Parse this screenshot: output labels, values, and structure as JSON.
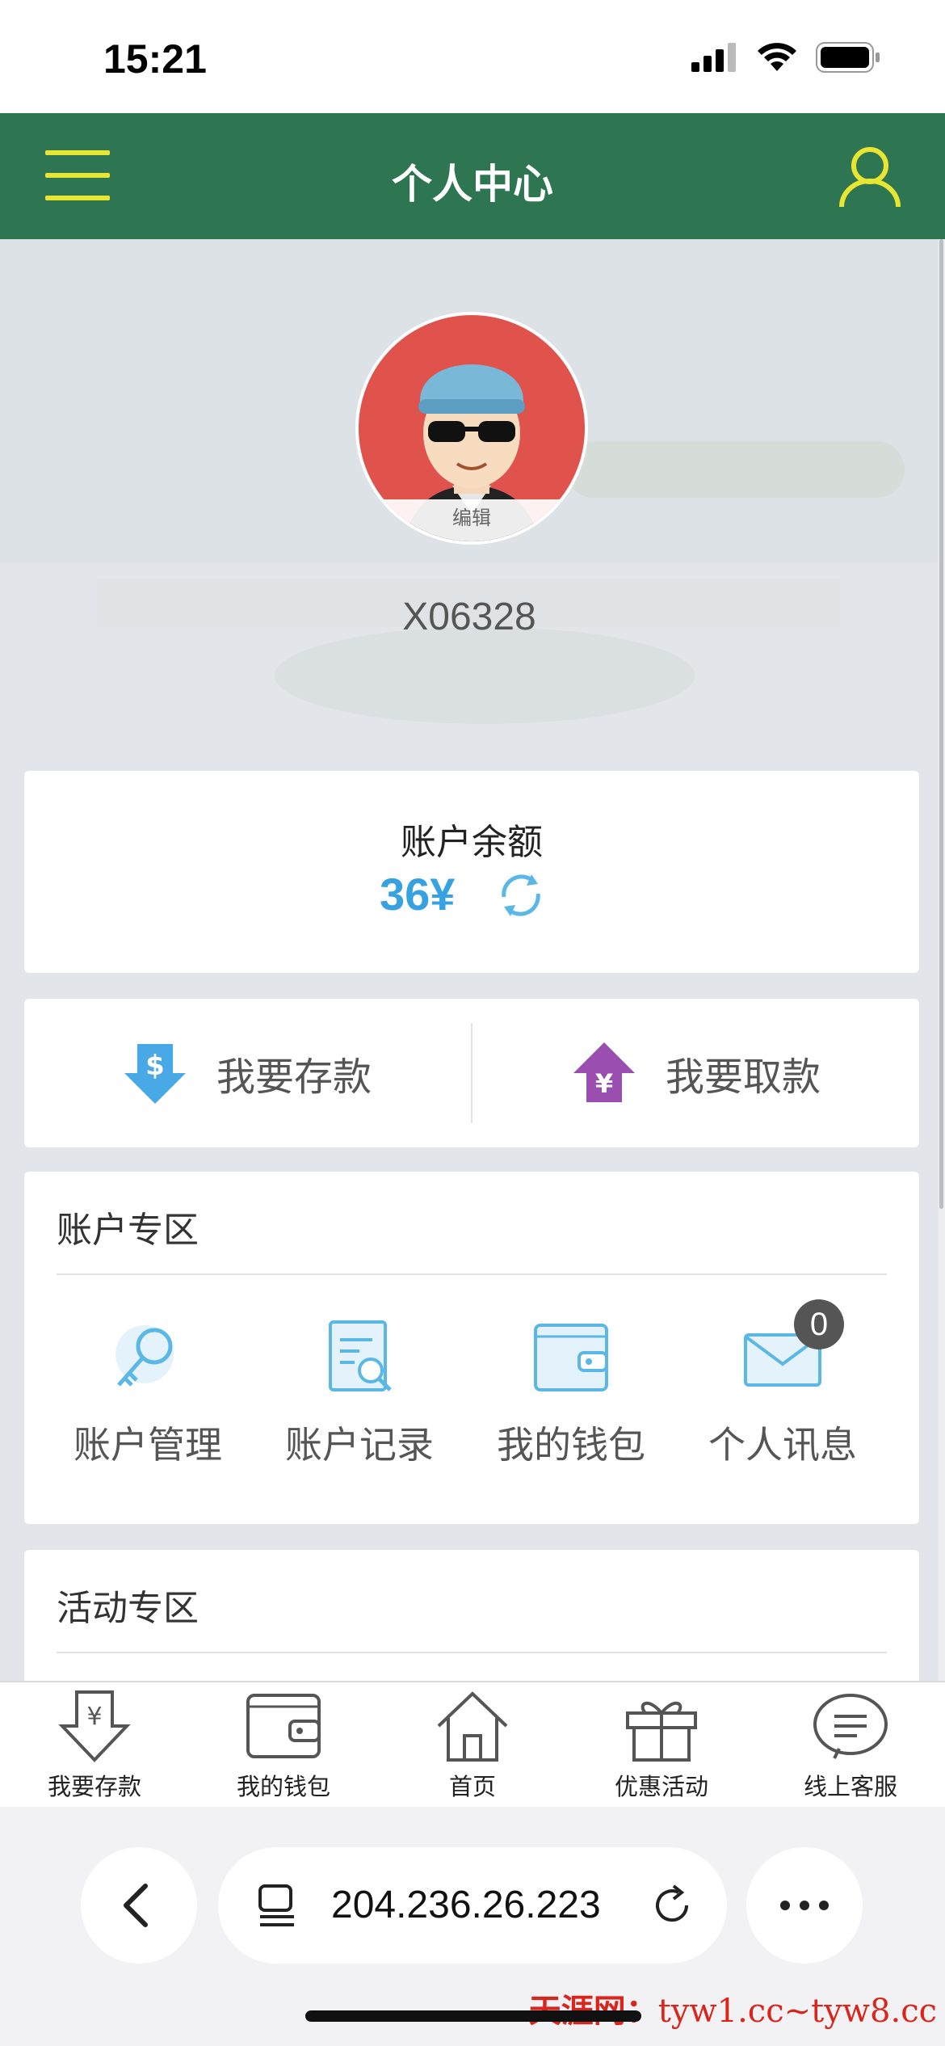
{
  "status_bar": {
    "time": "15:21"
  },
  "header": {
    "title": "个人中心"
  },
  "profile": {
    "avatar_edit_label": "编辑",
    "username": "X06328"
  },
  "balance": {
    "label": "账户余额",
    "amount": "36¥"
  },
  "actions": {
    "deposit_label": "我要存款",
    "withdraw_label": "我要取款"
  },
  "account_zone": {
    "title": "账户专区",
    "items": [
      {
        "label": "账户管理",
        "icon": "key-search-icon"
      },
      {
        "label": "账户记录",
        "icon": "document-search-icon"
      },
      {
        "label": "我的钱包",
        "icon": "wallet-icon"
      },
      {
        "label": "个人讯息",
        "icon": "envelope-icon",
        "badge": "0"
      }
    ]
  },
  "activity_zone": {
    "title": "活动专区"
  },
  "tabbar": {
    "items": [
      {
        "label": "我要存款",
        "icon": "deposit-icon"
      },
      {
        "label": "我的钱包",
        "icon": "wallet-icon"
      },
      {
        "label": "首页",
        "icon": "home-icon"
      },
      {
        "label": "优惠活动",
        "icon": "gift-icon"
      },
      {
        "label": "线上客服",
        "icon": "chat-icon"
      }
    ]
  },
  "browser": {
    "url": "204.236.26.223"
  },
  "watermark": {
    "site": "天涯网：",
    "domains": "tyw1.cc~tyw8.cc"
  },
  "colors": {
    "header_bg": "#2e7652",
    "accent_yellow": "#e8e632",
    "amount_blue": "#36a3e0",
    "badge_bg": "#555555"
  }
}
